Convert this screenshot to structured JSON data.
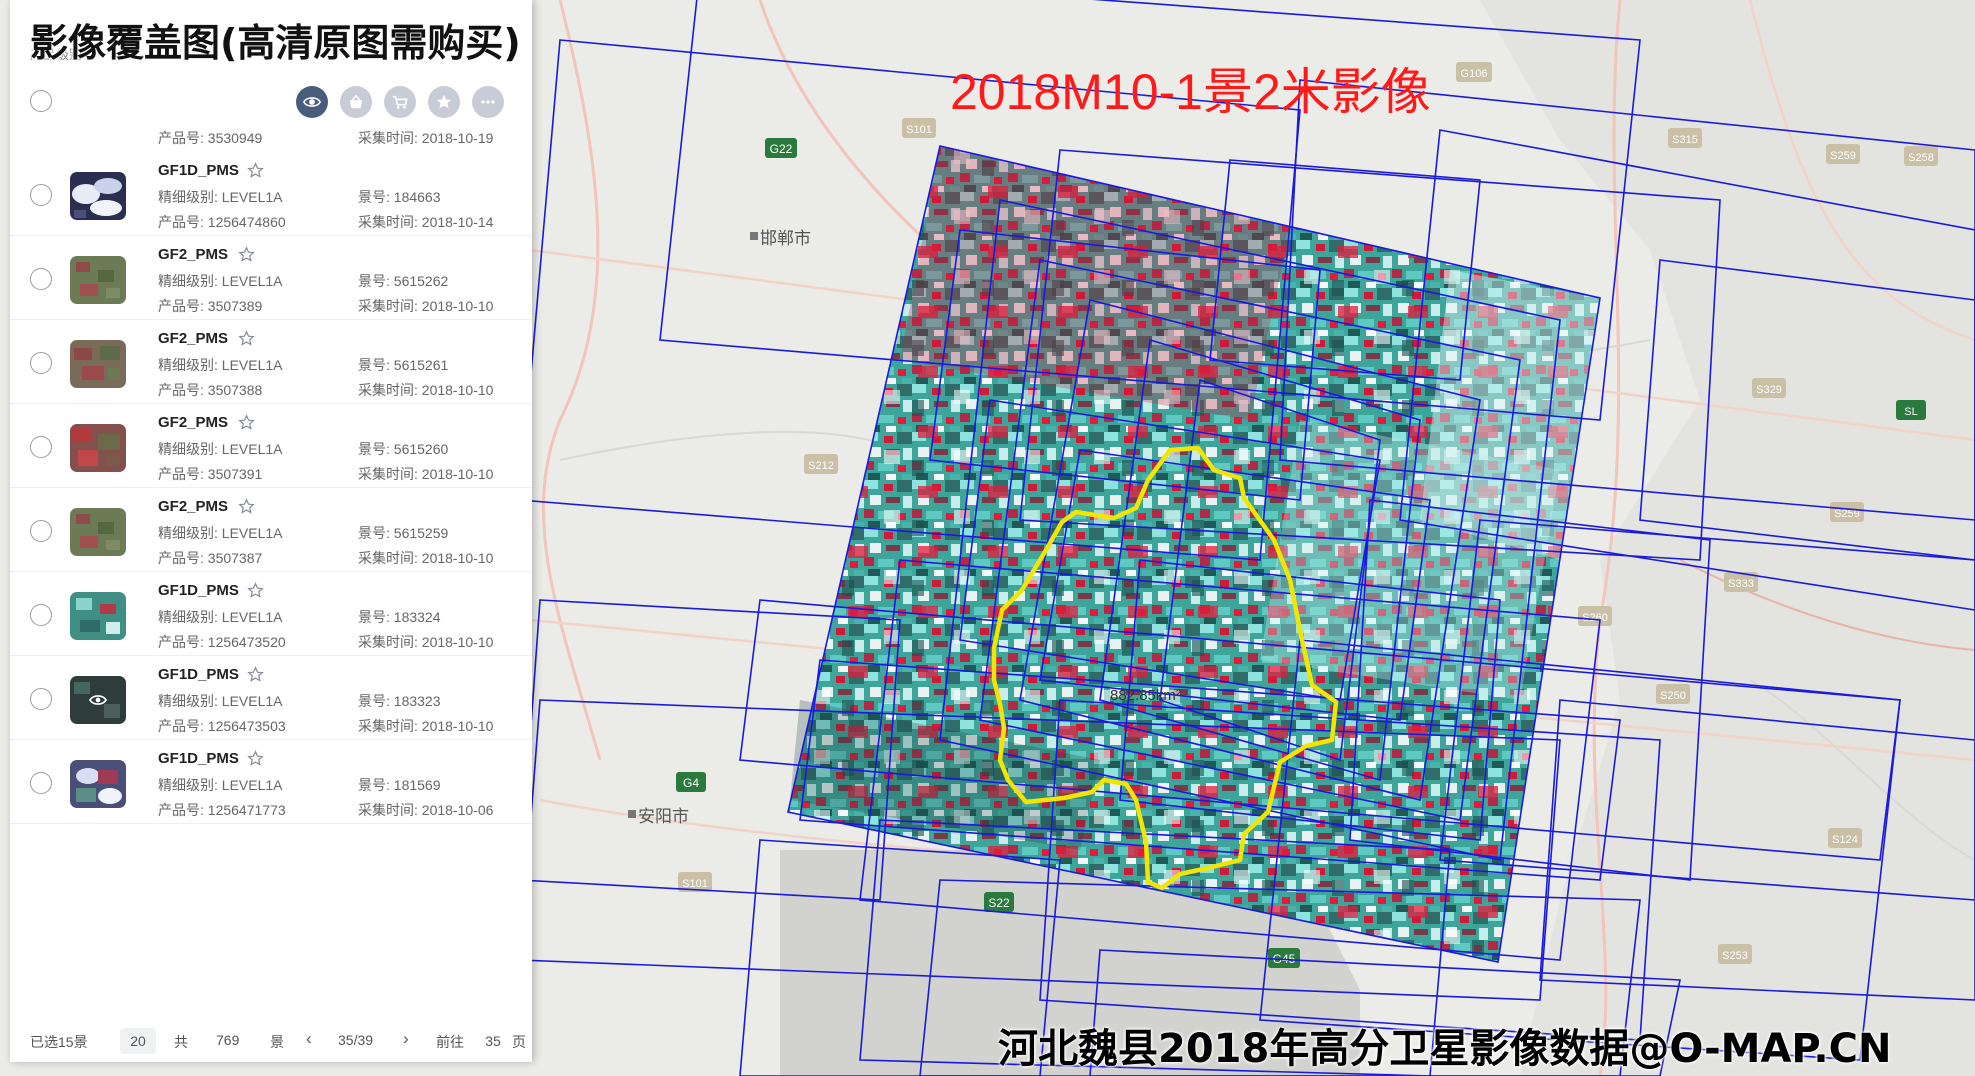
{
  "overlay": {
    "title": "影像覆盖图(高清原图需购买)",
    "scene_label": "2018M10-1景2米影像",
    "footer_caption": "河北魏县2018年高分卫星影像数据@O-MAP.CN"
  },
  "map": {
    "cities": [
      {
        "name": "邯郸市",
        "icon": "city-marker"
      },
      {
        "name": "安阳市",
        "icon": "city-marker"
      }
    ],
    "road_shields": [
      "G22",
      "G4",
      "S22",
      "G45",
      "G106",
      "S315",
      "S259",
      "S258",
      "S329",
      "SL",
      "S259",
      "S333",
      "S260",
      "S212",
      "S101",
      "S124",
      "S250",
      "S253",
      "S101"
    ],
    "area_label": "882.85km²",
    "colors": {
      "footprint": "#1a1adf",
      "boundary": "#f2e600",
      "ocean_base": "#eaeae6"
    }
  },
  "panel": {
    "top_text": "产品级别",
    "toolbar": {
      "icons": [
        "eye-icon",
        "basket-icon",
        "cart-icon",
        "star-icon",
        "more-icon"
      ]
    },
    "partial_row": {
      "product": "产品号: 3530949",
      "time": "采集时间: 2018-10-19"
    },
    "rows": [
      {
        "name": "GF1D_PMS",
        "level": "精细级别: LEVEL1A",
        "scene": "景号: 184663",
        "product": "产品号: 1256474860",
        "time": "采集时间: 2018-10-14",
        "thumb": "cloudy"
      },
      {
        "name": "GF2_PMS",
        "level": "精细级别: LEVEL1A",
        "scene": "景号: 5615262",
        "product": "产品号: 3507389",
        "time": "采集时间: 2018-10-10",
        "thumb": "green"
      },
      {
        "name": "GF2_PMS",
        "level": "精细级别: LEVEL1A",
        "scene": "景号: 5615261",
        "product": "产品号: 3507388",
        "time": "采集时间: 2018-10-10",
        "thumb": "redgreen"
      },
      {
        "name": "GF2_PMS",
        "level": "精细级别: LEVEL1A",
        "scene": "景号: 5615260",
        "product": "产品号: 3507391",
        "time": "采集时间: 2018-10-10",
        "thumb": "red"
      },
      {
        "name": "GF2_PMS",
        "level": "精细级别: LEVEL1A",
        "scene": "景号: 5615259",
        "product": "产品号: 3507387",
        "time": "采集时间: 2018-10-10",
        "thumb": "green"
      },
      {
        "name": "GF1D_PMS",
        "level": "精细级别: LEVEL1A",
        "scene": "景号: 183324",
        "product": "产品号: 1256473520",
        "time": "采集时间: 2018-10-10",
        "thumb": "teal"
      },
      {
        "name": "GF1D_PMS",
        "level": "精细级别: LEVEL1A",
        "scene": "景号: 183323",
        "product": "产品号: 1256473503",
        "time": "采集时间: 2018-10-10",
        "thumb": "eye"
      },
      {
        "name": "GF1D_PMS",
        "level": "精细级别: LEVEL1A",
        "scene": "景号: 181569",
        "product": "产品号: 1256471773",
        "time": "采集时间: 2018-10-06",
        "thumb": "mixed"
      }
    ],
    "pager": {
      "selected": "已选15景",
      "page_size": "20",
      "total_prefix": "共",
      "total": "769",
      "total_suffix": "景",
      "prev": "‹",
      "page_info": "35/39",
      "next": "›",
      "goto_label": "前往",
      "goto_value": "35",
      "goto_suffix": "页"
    }
  }
}
